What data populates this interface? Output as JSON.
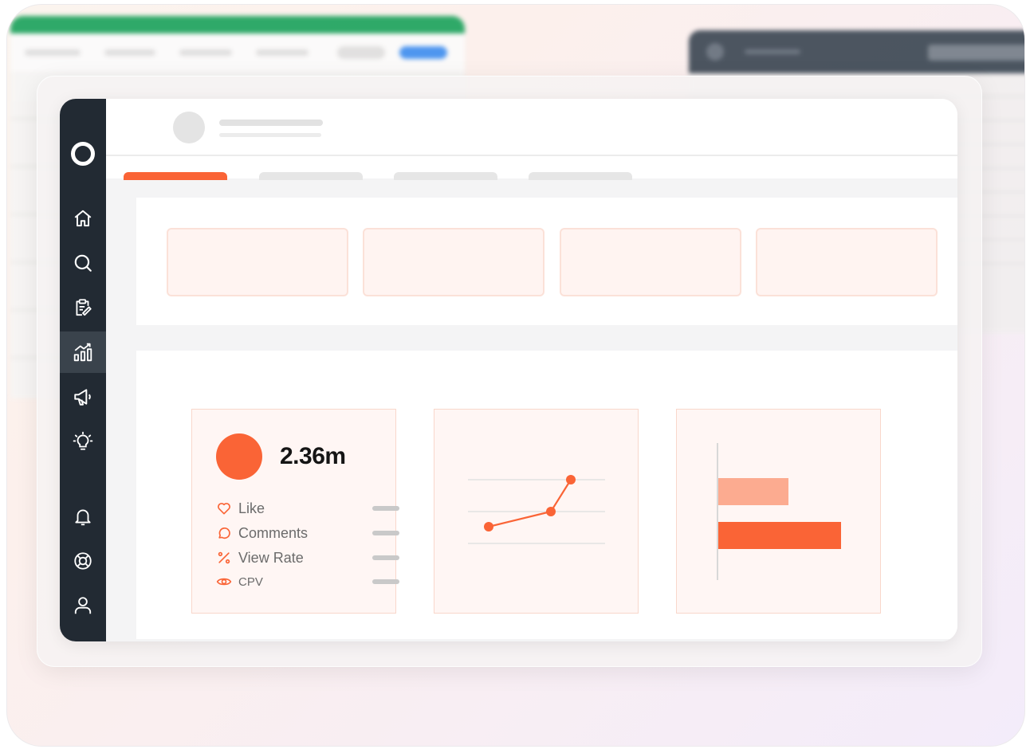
{
  "colors": {
    "accent": "#fa6436",
    "accent_light": "#fcab90",
    "sidebar_bg": "#222a33",
    "card_bg": "#fff6f4",
    "bg_window_topbar": "#19a15a",
    "bg_window_button": "#3b8cf0"
  },
  "sidebar": {
    "items": [
      {
        "icon": "home-icon"
      },
      {
        "icon": "search-icon"
      },
      {
        "icon": "clipboard-edit-icon"
      },
      {
        "icon": "analytics-icon",
        "active": true
      },
      {
        "icon": "megaphone-icon"
      },
      {
        "icon": "lightbulb-icon"
      },
      {
        "icon": "bell-icon"
      },
      {
        "icon": "lifebuoy-icon"
      },
      {
        "icon": "user-icon"
      }
    ]
  },
  "engagement_card": {
    "value": "2.36m",
    "metrics": [
      {
        "label": "Like",
        "icon": "heart-icon"
      },
      {
        "label": "Comments",
        "icon": "comment-icon"
      },
      {
        "label": "View Rate",
        "icon": "percent-icon"
      },
      {
        "label": "CPV",
        "icon": "eye-icon"
      }
    ]
  },
  "chart_data": [
    {
      "type": "line",
      "x": [
        1,
        2,
        3
      ],
      "y": [
        1,
        2,
        4
      ],
      "grid": true,
      "title": "",
      "xlabel": "",
      "ylabel": ""
    },
    {
      "type": "bar",
      "orientation": "horizontal",
      "categories": [
        "",
        ""
      ],
      "values": [
        88,
        154
      ],
      "title": "",
      "xlabel": "",
      "ylabel": ""
    }
  ]
}
